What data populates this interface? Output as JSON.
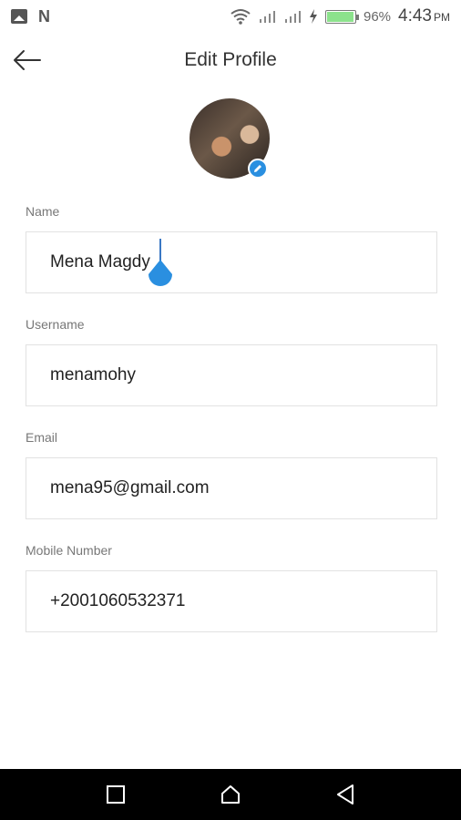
{
  "status_bar": {
    "battery_percent": "96%",
    "battery_level": 0.96,
    "time": "4:43",
    "ampm": "PM",
    "icons": [
      "image-icon",
      "n-icon",
      "wifi-icon",
      "signal-icon",
      "signal-icon",
      "charging-icon",
      "battery-icon"
    ]
  },
  "header": {
    "title": "Edit Profile",
    "back_icon": "arrow-left-icon"
  },
  "avatar": {
    "edit_icon": "pencil-icon",
    "badge_color": "#2a8fe0"
  },
  "form": {
    "name": {
      "label": "Name",
      "value": "Mena Magdy"
    },
    "username": {
      "label": "Username",
      "value": "menamohy"
    },
    "email": {
      "label": "Email",
      "value": "mena95@gmail.com"
    },
    "mobile": {
      "label": "Mobile Number",
      "value": "+2001060532371"
    }
  },
  "nav_bar": {
    "icons": [
      "recents-icon",
      "home-icon",
      "back-icon"
    ]
  },
  "colors": {
    "accent": "#3a78c4",
    "cursor_handle": "#2a8fe0"
  }
}
